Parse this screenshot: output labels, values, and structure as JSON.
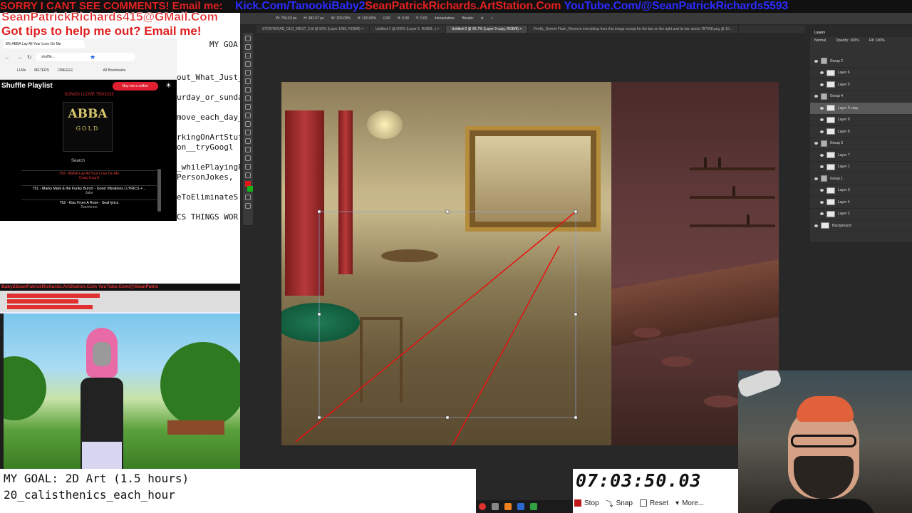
{
  "banner": {
    "line1": "SORRY I CANT SEE COMMENTS! Email me:",
    "line2_kick": "Kick.Com/TanookiBaby2",
    "line2_artstation": "SeanPatrickRichards.ArtStation.Com",
    "line2_youtube": "YouTube.Com/@SeanPatrickRichards5593",
    "email": "SeanPatrickRichards415@GMail.Com",
    "tips": "Got tips to help me out? Email me!"
  },
  "browser": {
    "tab_title": "8% ABBA Lay All Your Love On Me",
    "url": "shuffle...",
    "bookmarks": [
      "LLMs",
      "METERS",
      "OMEGLE",
      "All Bookmarks"
    ]
  },
  "playlist": {
    "title": "Shuffle Playlist",
    "coffee_button": "Buy me a coffee",
    "songs_label": "SONGS I LOVE  750/2233",
    "album_top": "ABBA",
    "album_bottom": "GOLD",
    "search_label": "Search",
    "items": [
      {
        "title": "750 - ABBA Lay All Your Love On Me",
        "artist": "Craig Cagnil"
      },
      {
        "title": "751 - Marky Mark & the Funky Bunch - Good Vibrations | LYRICS +...",
        "artist": "Jake"
      },
      {
        "title": "752 - Kiss From A Rose - Seal lyrics",
        "artist": "Rachimoo"
      }
    ]
  },
  "code_lines": [
    "MY GOA",
    "out_What_Just_",
    "urday_or_sunday",
    "move_each_day_",
    "rkingOnArtStuf",
    "on__tryGoogl",
    "_whilePlayingP",
    "PersonJokes,",
    "eToEliminateS",
    "CS THINGS WOR"
  ],
  "strip_text": "Baby2SeanPatrickRichards.ArtStation.Com YouTube.Com/@SeanPatric",
  "goal": {
    "line1": "MY GOAL: 2D Art (1.5 hours)",
    "line2": "20_calisthenics_each_hour"
  },
  "stopwatch": {
    "time": "07:03:50.03",
    "buttons": [
      "Stop",
      "Snap",
      "Reset",
      "More..."
    ]
  },
  "photoshop": {
    "options": [
      "W: 704.53 px",
      "H: 982.07 px",
      "W: 100.00%",
      "H: 100.00%",
      "0.00",
      "H: 0.00",
      "V: 0.00",
      "Interpolation:",
      "Bicubic"
    ],
    "tabs": [
      {
        "label": "STORYBOAD_OLD_WEST_2.tif @ 50% (Layer 1085, RGB/8) ×",
        "active": false
      },
      {
        "label": "Untitled-1 @ 600% (Layer 2, RGB/8...) ×",
        "active": false
      },
      {
        "label": "Untitled-2 @ 66.7% (Layer 9 copy, RGB/8) ×",
        "active": true
      },
      {
        "label": "Firefly_Gemini Flash_Remove everything from this image except for the bar on the right and its bar stools  787668.png @ 10...",
        "active": false
      }
    ],
    "layers_title": "Layers",
    "blend_mode": "Normal",
    "opacity": "Opacity: 100%",
    "fill": "Fill: 100%",
    "layers": [
      {
        "name": "Group 2",
        "type": "group",
        "selected": false
      },
      {
        "name": "Layer 6",
        "type": "layer",
        "selected": false
      },
      {
        "name": "Layer 5",
        "type": "layer",
        "selected": false
      },
      {
        "name": "Group 4",
        "type": "group",
        "selected": false
      },
      {
        "name": "Layer 9 copy",
        "type": "layer",
        "selected": true
      },
      {
        "name": "Layer 9",
        "type": "layer",
        "selected": false
      },
      {
        "name": "Layer 8",
        "type": "layer",
        "selected": false
      },
      {
        "name": "Group 3",
        "type": "group",
        "selected": false
      },
      {
        "name": "Layer 7",
        "type": "layer",
        "selected": false
      },
      {
        "name": "Layer 1",
        "type": "layer",
        "selected": false
      },
      {
        "name": "Group 1",
        "type": "group",
        "selected": false
      },
      {
        "name": "Layer 3",
        "type": "layer",
        "selected": false
      },
      {
        "name": "Layer 4",
        "type": "layer",
        "selected": false
      },
      {
        "name": "Layer 2",
        "type": "layer",
        "selected": false
      },
      {
        "name": "Background",
        "type": "layer",
        "selected": false
      }
    ]
  }
}
